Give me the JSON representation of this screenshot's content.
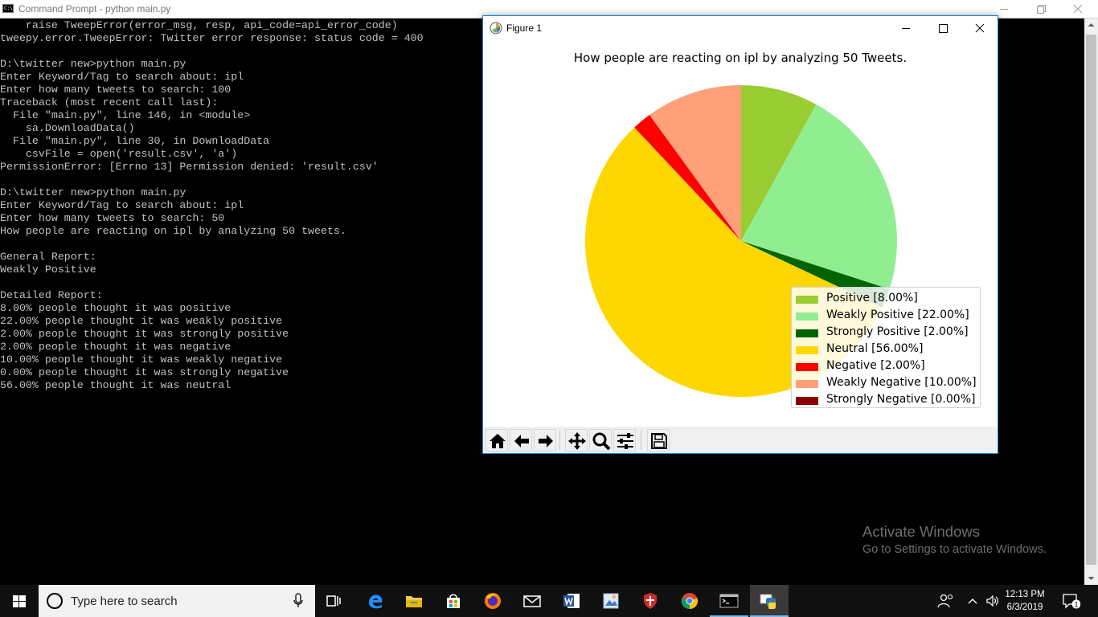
{
  "cmd": {
    "title": "Command Prompt - python  main.py",
    "icon": "cmd-icon",
    "icon_text": "C:\\",
    "lines": [
      "    raise TweepError(error_msg, resp, api_code=api_error_code)",
      "tweepy.error.TweepError: Twitter error response: status code = 400",
      "",
      "D:\\twitter new>python main.py",
      "Enter Keyword/Tag to search about: ipl",
      "Enter how many tweets to search: 100",
      "Traceback (most recent call last):",
      "  File \"main.py\", line 146, in <module>",
      "    sa.DownloadData()",
      "  File \"main.py\", line 30, in DownloadData",
      "    csvFile = open('result.csv', 'a')",
      "PermissionError: [Errno 13] Permission denied: 'result.csv'",
      "",
      "D:\\twitter new>python main.py",
      "Enter Keyword/Tag to search about: ipl",
      "Enter how many tweets to search: 50",
      "How people are reacting on ipl by analyzing 50 tweets.",
      "",
      "General Report:",
      "Weakly Positive",
      "",
      "Detailed Report:",
      "8.00% people thought it was positive",
      "22.00% people thought it was weakly positive",
      "2.00% people thought it was strongly positive",
      "2.00% people thought it was negative",
      "10.00% people thought it was weakly negative",
      "0.00% people thought it was strongly negative",
      "56.00% people thought it was neutral"
    ]
  },
  "figure": {
    "title": "Figure 1",
    "icon": "matplotlib-icon",
    "toolbar": [
      "home-icon",
      "back-arrow-icon",
      "forward-arrow-icon",
      "pan-icon",
      "zoom-icon",
      "subplots-icon",
      "save-icon"
    ]
  },
  "chart_data": {
    "type": "pie",
    "title": "How people are reacting on ipl by analyzing 50 Tweets.",
    "start_angle_deg": 90,
    "counterclock": false,
    "legend_position": "lower right",
    "slices": [
      {
        "label": "Positive [8.00%]",
        "value": 8,
        "color": "#9acd32"
      },
      {
        "label": "Weakly Positive [22.00%]",
        "value": 22,
        "color": "#90ee90"
      },
      {
        "label": "Strongly Positive [2.00%]",
        "value": 2,
        "color": "#006400"
      },
      {
        "label": "Neutral [56.00%]",
        "value": 56,
        "color": "#ffd700"
      },
      {
        "label": "Negative [2.00%]",
        "value": 2,
        "color": "#ff0000"
      },
      {
        "label": "Weakly Negative [10.00%]",
        "value": 10,
        "color": "#ffa07a"
      },
      {
        "label": "Strongly Negative [0.00%]",
        "value": 0,
        "color": "#8b0000"
      }
    ]
  },
  "watermark": {
    "title": "Activate Windows",
    "subtitle": "Go to Settings to activate Windows."
  },
  "taskbar": {
    "search_placeholder": "Type here to search",
    "apps": [
      "task-view-icon",
      "edge-icon",
      "file-explorer-icon",
      "store-icon",
      "firefox-icon",
      "mail-icon",
      "word-icon",
      "photos-icon",
      "shield-app-icon",
      "chrome-icon",
      "cmd-icon",
      "python-icon"
    ],
    "active_app": "python-icon",
    "time": "12:13 PM",
    "date": "6/3/2019",
    "notification_count": "1"
  }
}
